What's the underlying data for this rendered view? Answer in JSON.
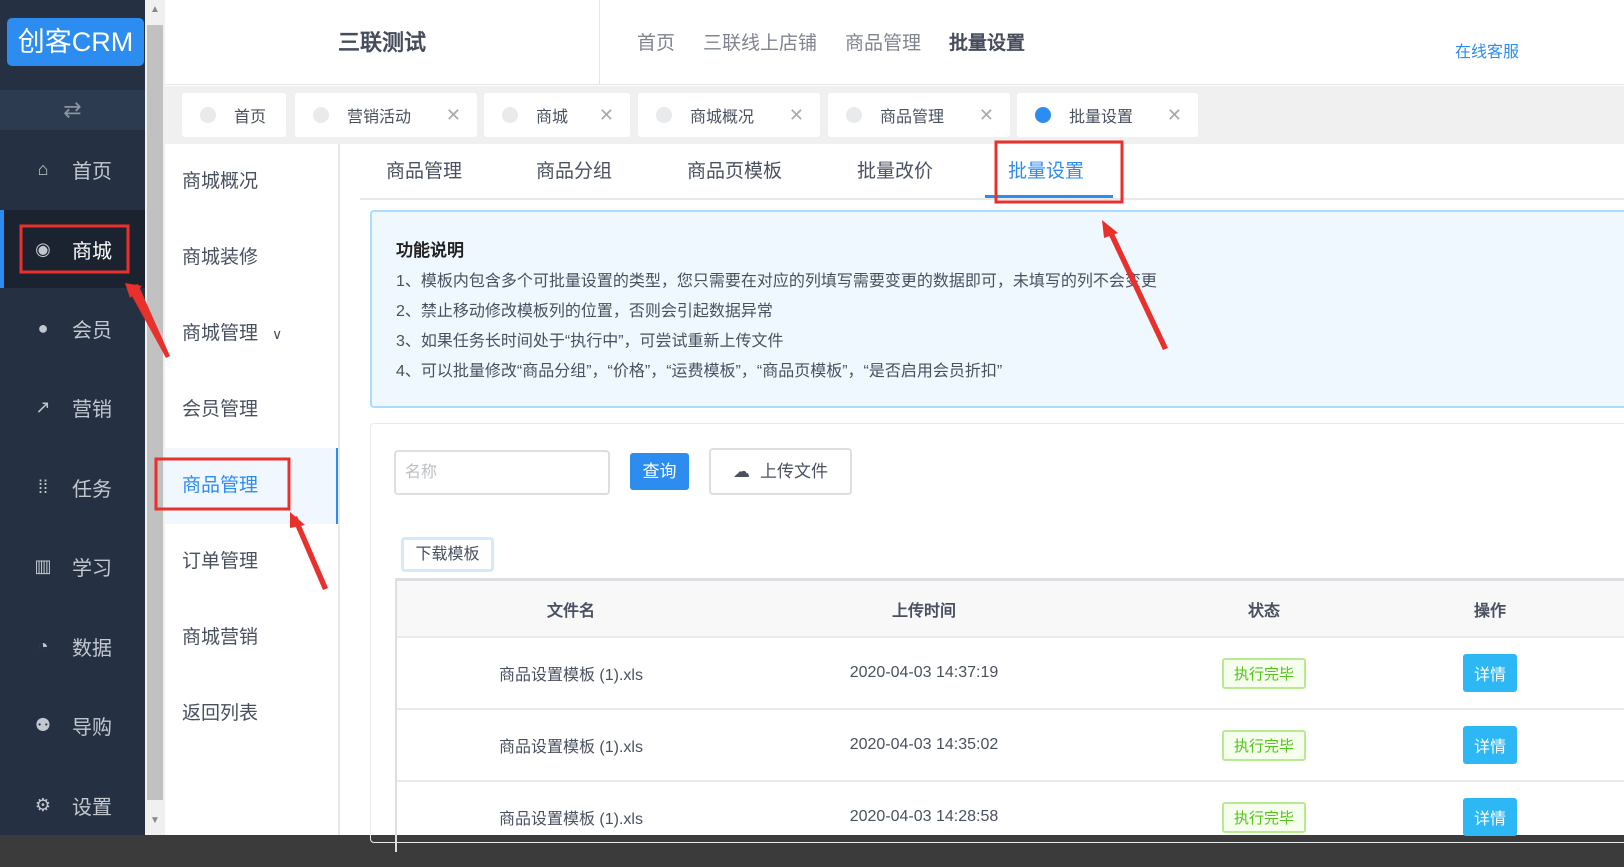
{
  "sidebar": {
    "logo": "创客CRM",
    "items": [
      {
        "label": "首页",
        "icon": "home-icon"
      },
      {
        "label": "商城",
        "icon": "store-icon"
      },
      {
        "label": "会员",
        "icon": "user-icon"
      },
      {
        "label": "营销",
        "icon": "trend-icon"
      },
      {
        "label": "任务",
        "icon": "grid-icon"
      },
      {
        "label": "学习",
        "icon": "book-icon"
      },
      {
        "label": "数据",
        "icon": "pie-icon"
      },
      {
        "label": "导购",
        "icon": "group-icon"
      },
      {
        "label": "设置",
        "icon": "gear-icon"
      }
    ]
  },
  "header": {
    "title": "三联测试",
    "nav": [
      "首页",
      "三联线上店铺",
      "商品管理",
      "批量设置"
    ],
    "service": "在线客服"
  },
  "tabs": [
    "首页",
    "营销活动",
    "商城",
    "商城概况",
    "商品管理",
    "批量设置"
  ],
  "submenu": [
    "商城概况",
    "商城装修",
    "商城管理",
    "会员管理",
    "商品管理",
    "订单管理",
    "商城营销",
    "返回列表"
  ],
  "page_tabs": [
    "商品管理",
    "商品分组",
    "商品页模板",
    "批量改价",
    "批量设置"
  ],
  "info": {
    "title": "功能说明",
    "lines": [
      "1、模板内包含多个可批量设置的类型，您只需要在对应的列填写需要变更的数据即可，未填写的列不会变更",
      "2、禁止移动修改模板列的位置，否则会引起数据异常",
      "3、如果任务长时间处于“执行中”，可尝试重新上传文件",
      "4、可以批量修改“商品分组”，“价格”，“运费模板”，“商品页模板”，“是否启用会员折扣”"
    ]
  },
  "search": {
    "placeholder": "名称",
    "query": "查询",
    "upload": "上传文件",
    "download": "下载模板"
  },
  "table": {
    "headers": [
      "文件名",
      "上传时间",
      "状态",
      "操作"
    ],
    "rows": [
      {
        "file": "商品设置模板 (1).xls",
        "time": "2020-04-03 14:37:19",
        "status": "执行完毕",
        "action": "详情"
      },
      {
        "file": "商品设置模板 (1).xls",
        "time": "2020-04-03 14:35:02",
        "status": "执行完毕",
        "action": "详情"
      },
      {
        "file": "商品设置模板 (1).xls",
        "time": "2020-04-03 14:28:58",
        "status": "执行完毕",
        "action": "详情"
      }
    ]
  }
}
